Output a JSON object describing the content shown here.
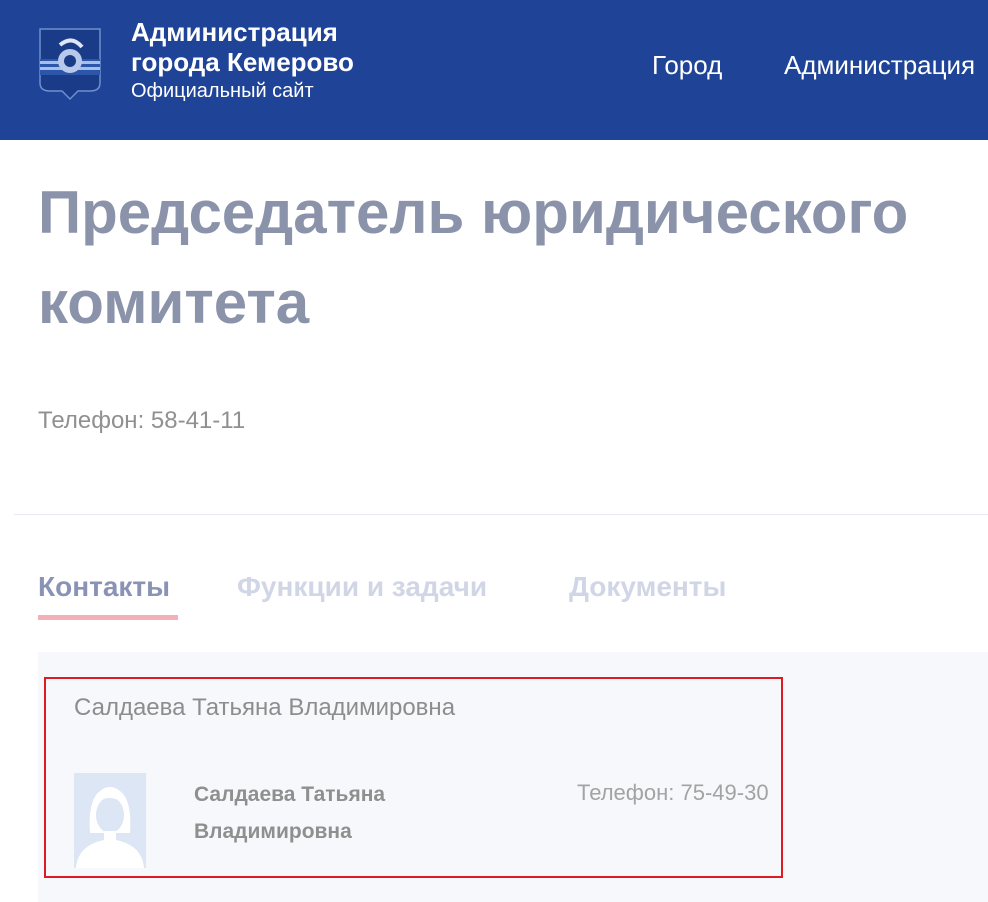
{
  "header": {
    "brand": {
      "title_line1": "Администрация",
      "title_line2": "города Кемерово",
      "subtitle": "Официальный сайт"
    },
    "nav": [
      {
        "label": "Город"
      },
      {
        "label": "Администрация"
      }
    ],
    "colors": {
      "background": "#1f4396"
    }
  },
  "page": {
    "title": "Председатель юридического комитета",
    "phone": "Телефон: 58-41-11"
  },
  "tabs": [
    {
      "label": "Контакты",
      "active": true
    },
    {
      "label": "Функции и задачи",
      "active": false
    },
    {
      "label": "Документы",
      "active": false
    }
  ],
  "contact_card": {
    "title": "Салдаева Татьяна Владимировна",
    "person": {
      "name_line1": "Салдаева Татьяна",
      "name_line2": "Владимировна",
      "phone": "Телефон: 75-49-30",
      "avatar_icon": "female-avatar-placeholder-icon"
    },
    "highlight_color": "#e01a22"
  }
}
